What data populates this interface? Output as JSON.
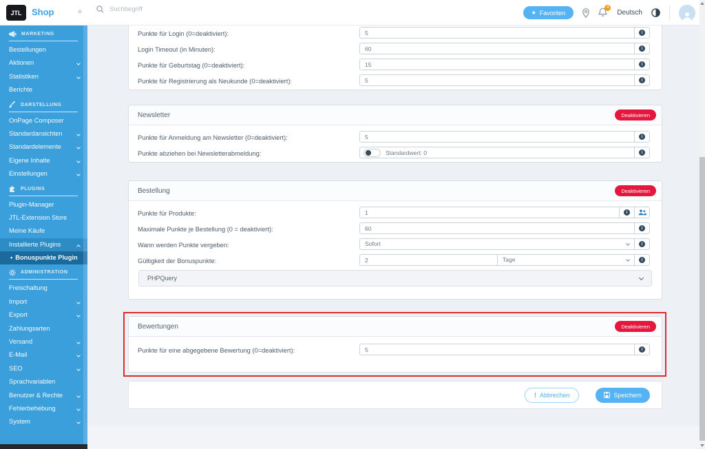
{
  "topbar": {
    "logo": "JTL",
    "brand": "Shop",
    "collapse": "«",
    "search_placeholder": "Suchbegriff",
    "favorites_label": "Favoriten",
    "notification_count": "4",
    "language": "Deutsch"
  },
  "sidebar": {
    "sections": [
      {
        "label": "MARKETING",
        "items": [
          "Bestellungen",
          "Aktionen",
          "Statistiken",
          "Berichte"
        ]
      },
      {
        "label": "DARSTELLUNG",
        "items": [
          "OnPage Composer",
          "Standardansichten",
          "Standardelemente",
          "Eigene Inhalte",
          "Einstellungen"
        ]
      },
      {
        "label": "PLUGINS",
        "items": [
          "Plugin-Manager",
          "JTL-Extension Store",
          "Meine Käufe",
          "Installierte Plugins",
          "Bonuspunkte Plugin"
        ]
      },
      {
        "label": "ADMINISTRATION",
        "items": [
          "Freischaltung",
          "Import",
          "Export",
          "Zahlungsarten",
          "Versand",
          "E-Mail",
          "SEO",
          "Sprachvariablen",
          "Benutzer & Rechte",
          "Fehlerbehebung",
          "System"
        ]
      }
    ]
  },
  "main": {
    "points": {
      "rows": [
        {
          "label": "Punkte für Login (0=deaktiviert):",
          "value": "5"
        },
        {
          "label": "Login Timeout (in Minuten):",
          "value": "60"
        },
        {
          "label": "Punkte für Geburtstag (0=deaktiviert):",
          "value": "15"
        },
        {
          "label": "Punkte für Registrierung als Neukunde (0=deaktiviert):",
          "value": "5"
        }
      ]
    },
    "newsletter": {
      "title": "Newsletter",
      "action": "Deaktivieren",
      "row1": {
        "label": "Punkte für Anmeldung am Newsletter (0=deaktiviert):",
        "value": "5"
      },
      "row2": {
        "label": "Punkte abziehen bei Newsletterabmeldung:",
        "toggle_label": "Standardwert: 0"
      }
    },
    "order": {
      "title": "Bestellung",
      "action": "Deaktivieren",
      "row1": {
        "label": "Punkte für Produkte:",
        "value": "1"
      },
      "row2": {
        "label": "Maximale Punkte je Bestellung (0 = deaktiviert):",
        "value": "60"
      },
      "row3": {
        "label": "Wann werden Punkte vergeben:",
        "value": "Sofort"
      },
      "row4": {
        "label": "Gültigkeit der Bonuspunkte:",
        "value": "2",
        "unit": "Tage"
      },
      "accordion": "PHPQuery"
    },
    "reviews": {
      "title": "Bewertungen",
      "action": "Deaktivieren",
      "row1": {
        "label": "Punkte für eine abgegebene Bewertung (0=deaktiviert):",
        "value": "5"
      }
    },
    "footer": {
      "cancel_icon": "!",
      "cancel": "Abbrechen",
      "save": "Speichern"
    }
  },
  "icons": {
    "topbar": [
      "search-icon",
      "star-icon",
      "location-pin-icon",
      "bell-icon",
      "contrast-icon",
      "user-avatar-icon"
    ],
    "sidebar": [
      "megaphone-icon",
      "paintbrush-icon",
      "puzzle-icon",
      "gear-icon"
    ],
    "form": [
      "info-icon",
      "users-icon",
      "chevron-down-icon",
      "save-icon"
    ]
  },
  "colors": {
    "sidebar": "#3B9FDB",
    "sidebar_active": "#2E8CC4",
    "sidebar_selected": "#1B6A9E",
    "danger": "#E5173F",
    "primary": "#55B3F3",
    "badge": "#F59B1B",
    "annotation": "#DD2B2B"
  }
}
